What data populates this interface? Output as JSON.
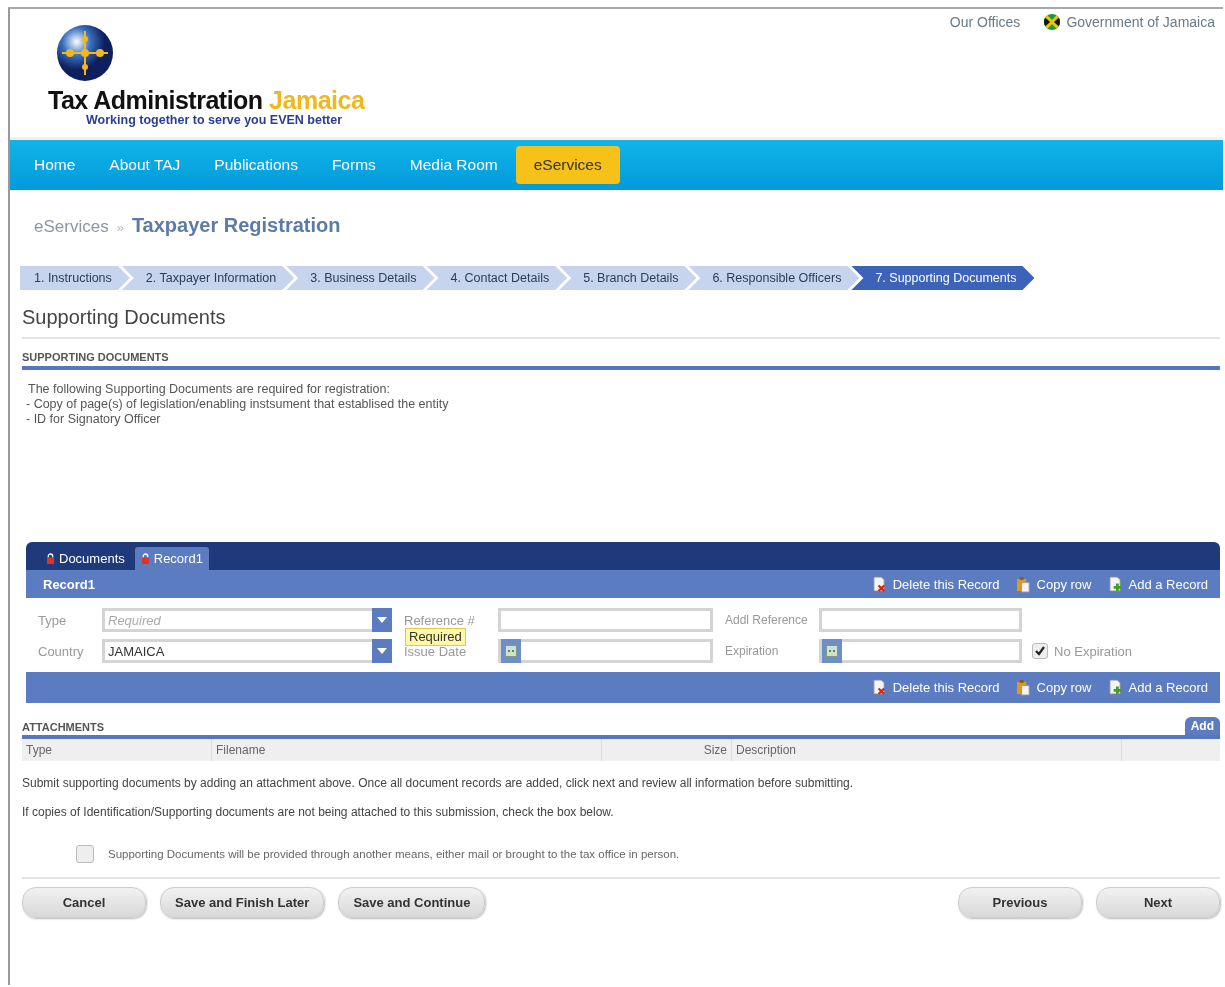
{
  "top_links": [
    {
      "label": "Our Offices",
      "kind": "plain"
    },
    {
      "label": "Government of Jamaica",
      "kind": "flag"
    }
  ],
  "logo": {
    "name": "Tax Administration",
    "accent": "Jamaica",
    "tagline": "Working together to serve you EVEN better"
  },
  "nav": [
    {
      "label": "Home",
      "selected": false
    },
    {
      "label": "About TAJ",
      "selected": false
    },
    {
      "label": "Publications",
      "selected": false
    },
    {
      "label": "Forms",
      "selected": false
    },
    {
      "label": "Media Room",
      "selected": false
    },
    {
      "label": "eServices",
      "selected": true
    }
  ],
  "breadcrumb": {
    "parent": "eServices",
    "separator": "»",
    "current": "Taxpayer Registration"
  },
  "steps": [
    {
      "label": "1. Instructions",
      "selected": false
    },
    {
      "label": "2. Taxpayer Information",
      "selected": false
    },
    {
      "label": "3. Business Details",
      "selected": false
    },
    {
      "label": "4. Contact Details",
      "selected": false
    },
    {
      "label": "5. Branch Details",
      "selected": false
    },
    {
      "label": "6. Responsible Officers",
      "selected": false
    },
    {
      "label": "7. Supporting Documents",
      "selected": true
    }
  ],
  "page_title": "Supporting Documents",
  "section_title": "SUPPORTING DOCUMENTS",
  "requirements": {
    "intro": "The following Supporting Documents are required for registration:",
    "items": [
      "- Copy of page(s) of legislation/enabling instsument that establised the entity",
      "- ID for Signatory Officer"
    ]
  },
  "panel": {
    "tabs": [
      {
        "label": "Documents",
        "selected": false
      },
      {
        "label": "Record1",
        "selected": true
      }
    ],
    "record_title": "Record1",
    "actions": [
      {
        "label": "Delete this Record",
        "kind": "delete"
      },
      {
        "label": "Copy row",
        "kind": "copy"
      },
      {
        "label": "Add a Record",
        "kind": "add"
      }
    ],
    "rows": [
      {
        "fields": [
          {
            "label": "Type",
            "kind": "select",
            "placeholder": "Required"
          },
          {
            "label": "Reference #",
            "kind": "text"
          },
          {
            "label": "Addl Reference",
            "kind": "text"
          }
        ]
      },
      {
        "fields": [
          {
            "label": "Country",
            "kind": "select",
            "value": "JAMAICA"
          },
          {
            "label": "Issue Date",
            "kind": "date"
          },
          {
            "label": "Expiration",
            "kind": "date"
          },
          {
            "label": "No Expiration",
            "kind": "checkbox",
            "checked": true
          }
        ]
      }
    ],
    "tooltip": "Required",
    "bottom_actions": [
      {
        "label": "Delete this Record",
        "kind": "delete"
      },
      {
        "label": "Copy row",
        "kind": "copy"
      },
      {
        "label": "Add a Record",
        "kind": "add"
      }
    ]
  },
  "attachments": {
    "title": "ATTACHMENTS",
    "add_label": "Add",
    "columns": [
      "Type",
      "Filename",
      "Size",
      "Description"
    ]
  },
  "instructions": [
    "Submit supporting documents by adding an attachment above. Once all document records are added, click next and review all information before submitting.",
    "If copies of Identification/Supporting documents are not being attached to this submission, check the box below."
  ],
  "alt_delivery": {
    "label": "Supporting Documents will be provided through another means, either mail or brought to the tax office in person.",
    "checked": false
  },
  "buttons_left": [
    "Cancel",
    "Save and Finish Later",
    "Save and Continue"
  ],
  "buttons_right": [
    "Previous",
    "Next"
  ]
}
